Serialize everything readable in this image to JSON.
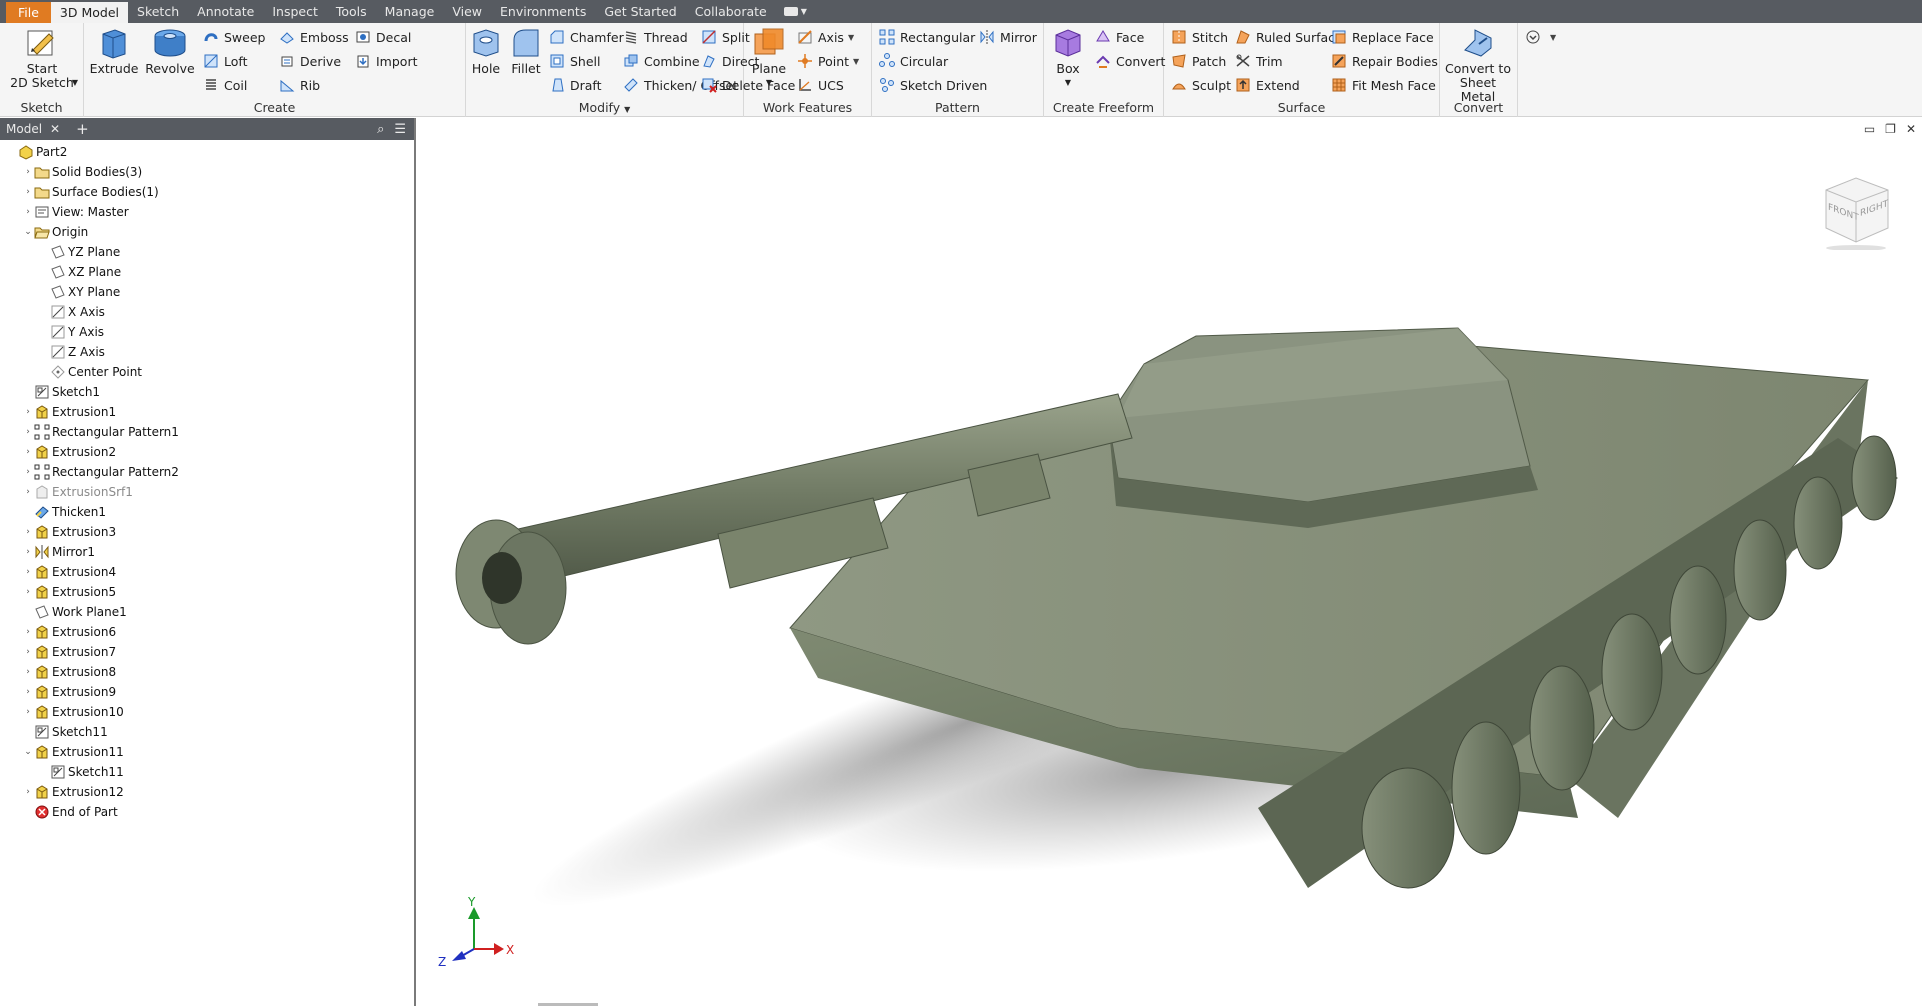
{
  "menu": {
    "tabs": [
      "File",
      "3D Model",
      "Sketch",
      "Annotate",
      "Inspect",
      "Tools",
      "Manage",
      "View",
      "Environments",
      "Get Started",
      "Collaborate"
    ],
    "active": "3D Model"
  },
  "ribbon": {
    "sketch": {
      "title": "Sketch",
      "start_label": "Start\n2D Sketch"
    },
    "create": {
      "title": "Create",
      "extrude": "Extrude",
      "revolve": "Revolve",
      "sweep": "Sweep",
      "loft": "Loft",
      "coil": "Coil",
      "emboss": "Emboss",
      "derive": "Derive",
      "rib": "Rib",
      "decal": "Decal",
      "import": "Import"
    },
    "modify": {
      "title": "Modify",
      "hole": "Hole",
      "fillet": "Fillet",
      "chamfer": "Chamfer",
      "shell": "Shell",
      "draft": "Draft",
      "thread": "Thread",
      "combine": "Combine",
      "thicken": "Thicken/ Offset",
      "split": "Split",
      "direct": "Direct",
      "delete_face": "Delete Face"
    },
    "work": {
      "title": "Work Features",
      "plane": "Plane",
      "axis": "Axis",
      "point": "Point",
      "ucs": "UCS"
    },
    "pattern": {
      "title": "Pattern",
      "rectangular": "Rectangular",
      "circular": "Circular",
      "sketch_driven": "Sketch Driven",
      "mirror": "Mirror"
    },
    "freeform": {
      "title": "Create Freeform",
      "box": "Box",
      "face": "Face",
      "convert": "Convert"
    },
    "surface": {
      "title": "Surface",
      "stitch": "Stitch",
      "patch": "Patch",
      "sculpt": "Sculpt",
      "ruled": "Ruled Surface",
      "trim": "Trim",
      "extend": "Extend",
      "replace": "Replace Face",
      "repair": "Repair Bodies",
      "fitmesh": "Fit Mesh Face"
    },
    "convert": {
      "title": "Convert",
      "sheet_metal": "Convert to\nSheet Metal"
    }
  },
  "browser": {
    "tab_label": "Model",
    "nodes": [
      {
        "label": "Part2",
        "indent": 0,
        "exp": "",
        "icon": "part"
      },
      {
        "label": "Solid Bodies(3)",
        "indent": 1,
        "exp": ">",
        "icon": "folder"
      },
      {
        "label": "Surface Bodies(1)",
        "indent": 1,
        "exp": ">",
        "icon": "folder"
      },
      {
        "label": "View: Master",
        "indent": 1,
        "exp": ">",
        "icon": "view"
      },
      {
        "label": "Origin",
        "indent": 1,
        "exp": "v",
        "icon": "folder-open"
      },
      {
        "label": "YZ Plane",
        "indent": 2,
        "exp": "",
        "icon": "plane"
      },
      {
        "label": "XZ Plane",
        "indent": 2,
        "exp": "",
        "icon": "plane"
      },
      {
        "label": "XY Plane",
        "indent": 2,
        "exp": "",
        "icon": "plane"
      },
      {
        "label": "X Axis",
        "indent": 2,
        "exp": "",
        "icon": "axis"
      },
      {
        "label": "Y Axis",
        "indent": 2,
        "exp": "",
        "icon": "axis"
      },
      {
        "label": "Z Axis",
        "indent": 2,
        "exp": "",
        "icon": "axis"
      },
      {
        "label": "Center Point",
        "indent": 2,
        "exp": "",
        "icon": "point"
      },
      {
        "label": "Sketch1",
        "indent": 1,
        "exp": "",
        "icon": "sketch"
      },
      {
        "label": "Extrusion1",
        "indent": 1,
        "exp": ">",
        "icon": "extrude"
      },
      {
        "label": "Rectangular Pattern1",
        "indent": 1,
        "exp": ">",
        "icon": "pattern"
      },
      {
        "label": "Extrusion2",
        "indent": 1,
        "exp": ">",
        "icon": "extrude"
      },
      {
        "label": "Rectangular Pattern2",
        "indent": 1,
        "exp": ">",
        "icon": "pattern"
      },
      {
        "label": "ExtrusionSrf1",
        "indent": 1,
        "exp": ">",
        "icon": "surface",
        "dim": true
      },
      {
        "label": "Thicken1",
        "indent": 1,
        "exp": "",
        "icon": "thicken"
      },
      {
        "label": "Extrusion3",
        "indent": 1,
        "exp": ">",
        "icon": "extrude"
      },
      {
        "label": "Mirror1",
        "indent": 1,
        "exp": ">",
        "icon": "mirror"
      },
      {
        "label": "Extrusion4",
        "indent": 1,
        "exp": ">",
        "icon": "extrude"
      },
      {
        "label": "Extrusion5",
        "indent": 1,
        "exp": ">",
        "icon": "extrude"
      },
      {
        "label": "Work Plane1",
        "indent": 1,
        "exp": "",
        "icon": "plane"
      },
      {
        "label": "Extrusion6",
        "indent": 1,
        "exp": ">",
        "icon": "extrude"
      },
      {
        "label": "Extrusion7",
        "indent": 1,
        "exp": ">",
        "icon": "extrude"
      },
      {
        "label": "Extrusion8",
        "indent": 1,
        "exp": ">",
        "icon": "extrude"
      },
      {
        "label": "Extrusion9",
        "indent": 1,
        "exp": ">",
        "icon": "extrude"
      },
      {
        "label": "Extrusion10",
        "indent": 1,
        "exp": ">",
        "icon": "extrude"
      },
      {
        "label": "Sketch11",
        "indent": 1,
        "exp": "",
        "icon": "sketch"
      },
      {
        "label": "Extrusion11",
        "indent": 1,
        "exp": "v",
        "icon": "extrude"
      },
      {
        "label": "Sketch11",
        "indent": 2,
        "exp": "",
        "icon": "sketch"
      },
      {
        "label": "Extrusion12",
        "indent": 1,
        "exp": ">",
        "icon": "extrude"
      },
      {
        "label": "End of Part",
        "indent": 1,
        "exp": "",
        "icon": "end"
      }
    ]
  },
  "viewcube": {
    "front": "FRONT",
    "right": "RIGHT"
  },
  "triad": {
    "x": "X",
    "y": "Y",
    "z": "Z"
  },
  "colors": {
    "menubar": "#575b61",
    "file_tab": "#e07b22",
    "ribbon": "#f5f5f5",
    "tank": "#7d8670"
  }
}
